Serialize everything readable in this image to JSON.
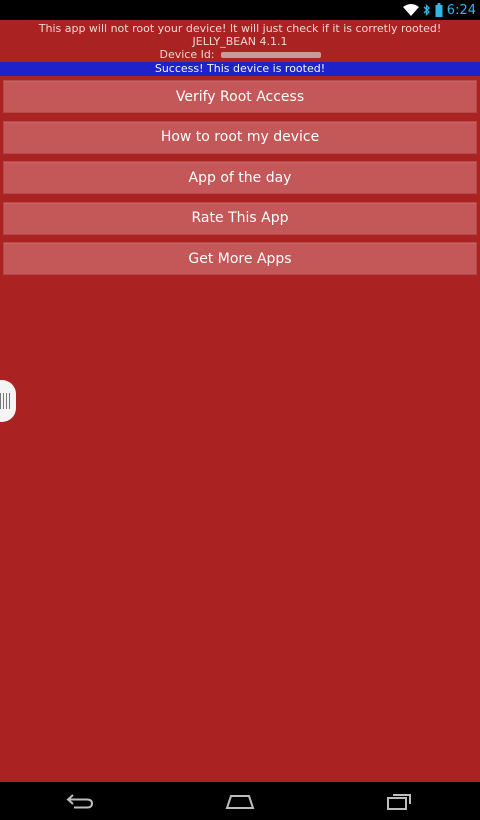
{
  "status_bar": {
    "time": "6:24",
    "icons": [
      "wifi-icon",
      "bluetooth-icon",
      "battery-icon"
    ]
  },
  "info": {
    "disclaimer": "This app will not root your device! It will just check if it is corretly rooted!",
    "os_version": "JELLY_BEAN 4.1.1",
    "device_id_label": "Device Id:"
  },
  "banner": {
    "text": "Success! This device is rooted!"
  },
  "buttons": [
    {
      "label": "Verify Root Access"
    },
    {
      "label": "How to root my device"
    },
    {
      "label": "App of the day"
    },
    {
      "label": "Rate This App"
    },
    {
      "label": "Get More Apps"
    }
  ],
  "nav": {
    "icons": [
      "back-icon",
      "home-icon",
      "recent-apps-icon"
    ]
  },
  "colors": {
    "app_background": "#ab2222",
    "button_background": "#c45757",
    "banner_background": "#1f22c9"
  }
}
